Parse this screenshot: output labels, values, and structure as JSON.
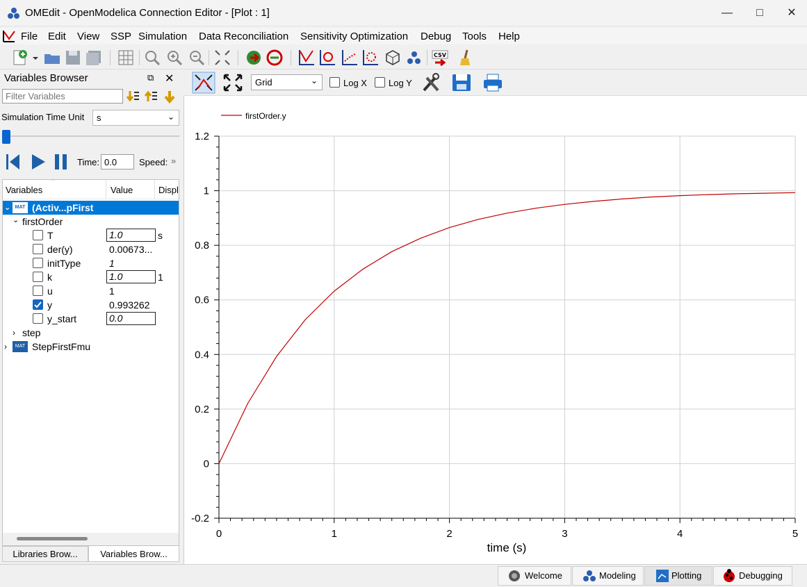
{
  "window": {
    "title": "OMEdit - OpenModelica Connection Editor - [Plot : 1]"
  },
  "menu": [
    "File",
    "Edit",
    "View",
    "SSP",
    "Simulation",
    "Data Reconciliation",
    "Sensitivity Optimization",
    "Debug",
    "Tools",
    "Help"
  ],
  "variables_browser": {
    "title": "Variables Browser",
    "filter_placeholder": "Filter Variables",
    "sim_time_unit_label": "Simulation Time Unit",
    "sim_time_unit_value": "s",
    "time_label": "Time:",
    "time_value": "0.0",
    "speed_label": "Speed:",
    "columns": [
      "Variables",
      "Value",
      "Displa"
    ],
    "root_label": "(Activ...pFirst",
    "group_label": "firstOrder",
    "vars": [
      {
        "name": "T",
        "value": "1.0",
        "unit": "s",
        "editable": true,
        "checked": false
      },
      {
        "name": "der(y)",
        "value": "0.00673...",
        "unit": "",
        "editable": false,
        "italic": false,
        "checked": false
      },
      {
        "name": "initType",
        "value": "1",
        "unit": "",
        "editable": false,
        "italic": true,
        "checked": false
      },
      {
        "name": "k",
        "value": "1.0",
        "unit": "1",
        "editable": true,
        "checked": false
      },
      {
        "name": "u",
        "value": "1",
        "unit": "",
        "editable": false,
        "italic": false,
        "checked": false
      },
      {
        "name": "y",
        "value": "0.993262",
        "unit": "",
        "editable": false,
        "italic": false,
        "checked": true
      },
      {
        "name": "y_start",
        "value": "0.0",
        "unit": "",
        "editable": true,
        "checked": false
      }
    ],
    "step_label": "step",
    "second_root_label": "StepFirstFmu",
    "tab_libraries": "Libraries Brow...",
    "tab_variables": "Variables Brow..."
  },
  "plot_toolbar": {
    "grid_select": "Grid",
    "log_x": "Log X",
    "log_y": "Log Y"
  },
  "perspectives": [
    "Welcome",
    "Modeling",
    "Plotting",
    "Debugging"
  ],
  "colors": {
    "series": "#c00000",
    "selection": "#0078d7"
  },
  "chart_data": {
    "type": "line",
    "xlabel": "time (s)",
    "ylabel": "",
    "xlim": [
      0,
      5
    ],
    "ylim": [
      -0.2,
      1.2
    ],
    "x_ticks": [
      "0",
      "1",
      "2",
      "3",
      "4",
      "5"
    ],
    "y_ticks": [
      "-0.2",
      "0",
      "0.2",
      "0.4",
      "0.6",
      "0.8",
      "1",
      "1.2"
    ],
    "grid": true,
    "legend_position": "top-left",
    "series": [
      {
        "name": "firstOrder.y",
        "x": [
          0,
          0.25,
          0.5,
          0.75,
          1,
          1.25,
          1.5,
          1.75,
          2,
          2.25,
          2.5,
          2.75,
          3,
          3.25,
          3.5,
          3.75,
          4,
          4.25,
          4.5,
          4.75,
          5
        ],
        "y": [
          0,
          0.221,
          0.393,
          0.528,
          0.632,
          0.713,
          0.777,
          0.826,
          0.865,
          0.895,
          0.918,
          0.936,
          0.95,
          0.961,
          0.97,
          0.977,
          0.982,
          0.986,
          0.989,
          0.991,
          0.993
        ]
      }
    ]
  }
}
